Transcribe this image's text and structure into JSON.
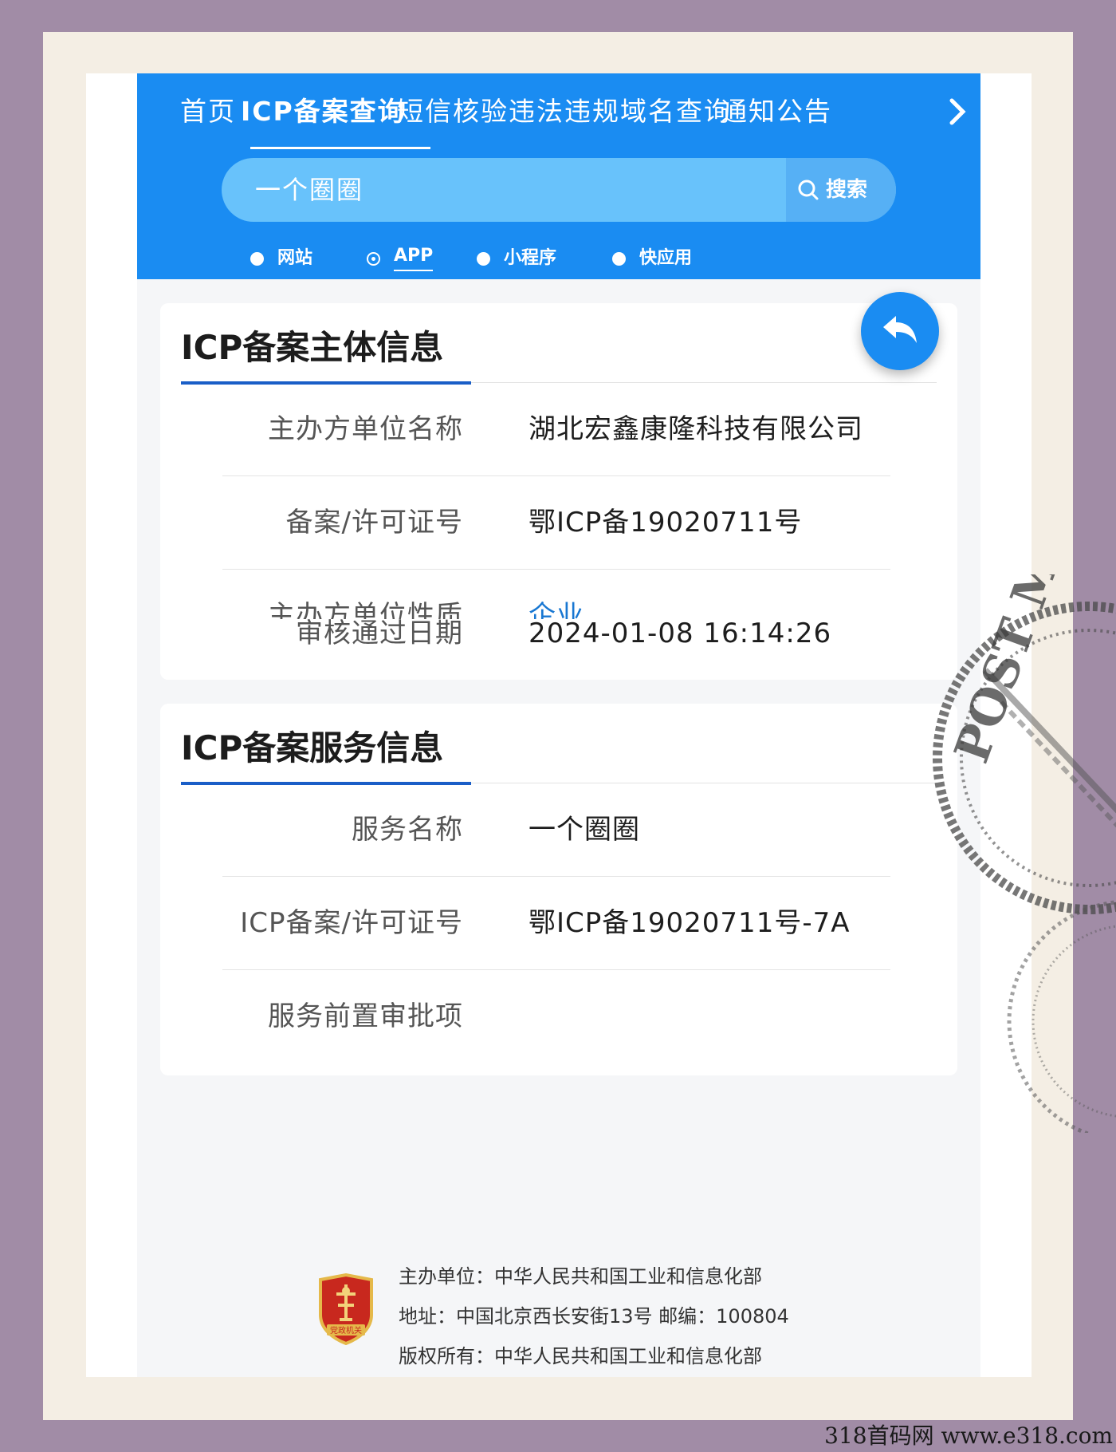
{
  "nav": {
    "items": [
      "首页",
      "ICP备案查询",
      "短信核验",
      "违法违规域名查询",
      "通知公告"
    ],
    "active_index": 1,
    "more_icon": "chevron-right-icon"
  },
  "search": {
    "value": "一个圈圈",
    "button_label": "搜索",
    "button_icon": "search-icon"
  },
  "type_filter": {
    "options": [
      "网站",
      "APP",
      "小程序",
      "快应用"
    ],
    "selected": "APP"
  },
  "subject_info": {
    "title": "ICP备案主体信息",
    "rows": [
      {
        "label": "主办方单位名称",
        "value": "湖北宏鑫康隆科技有限公司"
      },
      {
        "label": "备案/许可证号",
        "value": "鄂ICP备19020711号"
      },
      {
        "label": "主办方单位性质",
        "value": "企业"
      },
      {
        "label": "审核通过日期",
        "value": "2024-01-08 16:14:26"
      }
    ]
  },
  "service_info": {
    "title": "ICP备案服务信息",
    "rows": [
      {
        "label": "服务名称",
        "value": "一个圈圈"
      },
      {
        "label": "ICP备案/许可证号",
        "value": "鄂ICP备19020711号-7A"
      },
      {
        "label": "服务前置审批项",
        "value": ""
      }
    ]
  },
  "back_button_icon": "back-arrow-icon",
  "footer": {
    "emblem_text": "党政机关",
    "lines": [
      "主办单位：中华人民共和国工业和信息化部",
      "地址：中国北京西长安街13号 邮编：100804",
      "版权所有：中华人民共和国工业和信息化部"
    ]
  },
  "postmark_text": "POST MAIL",
  "watermark": "318首码网 www.e318.com",
  "colors": {
    "header_blue": "#1a8cf2",
    "stamp_border": "#a18ca6",
    "title_underline": "#1a5ec7",
    "link_blue": "#1877d2"
  }
}
